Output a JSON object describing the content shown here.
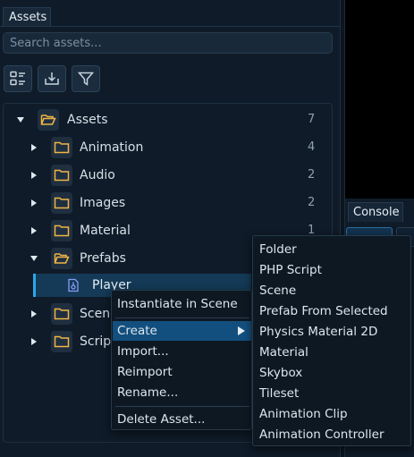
{
  "assets_panel": {
    "tab_label": "Assets",
    "search_placeholder": "Search assets...",
    "toolbar": [
      "list-view-icon",
      "import-icon",
      "filter-icon"
    ]
  },
  "tree": {
    "root": {
      "label": "Assets",
      "count": "7"
    },
    "items": [
      {
        "label": "Animation",
        "count": "4"
      },
      {
        "label": "Audio",
        "count": "2"
      },
      {
        "label": "Images",
        "count": "2"
      },
      {
        "label": "Material",
        "count": "1"
      },
      {
        "label": "Prefabs",
        "count": ""
      },
      {
        "label": "Player",
        "count": ""
      },
      {
        "label": "Scene",
        "count": ""
      },
      {
        "label": "Script",
        "count": ""
      }
    ]
  },
  "context_menu": {
    "items": [
      "Instantiate in Scene",
      "Create",
      "Import...",
      "Reimport",
      "Rename...",
      "Delete Asset..."
    ]
  },
  "create_submenu": {
    "items": [
      "Folder",
      "PHP Script",
      "Scene",
      "Prefab From Selected",
      "Physics Material 2D",
      "Material",
      "Skybox",
      "Tileset",
      "Animation Clip",
      "Animation Controller"
    ]
  },
  "console": {
    "tab_label": "Console"
  },
  "colors": {
    "accent": "#2aa8e8",
    "selection": "#134f7e",
    "folder": "#f0b545"
  }
}
